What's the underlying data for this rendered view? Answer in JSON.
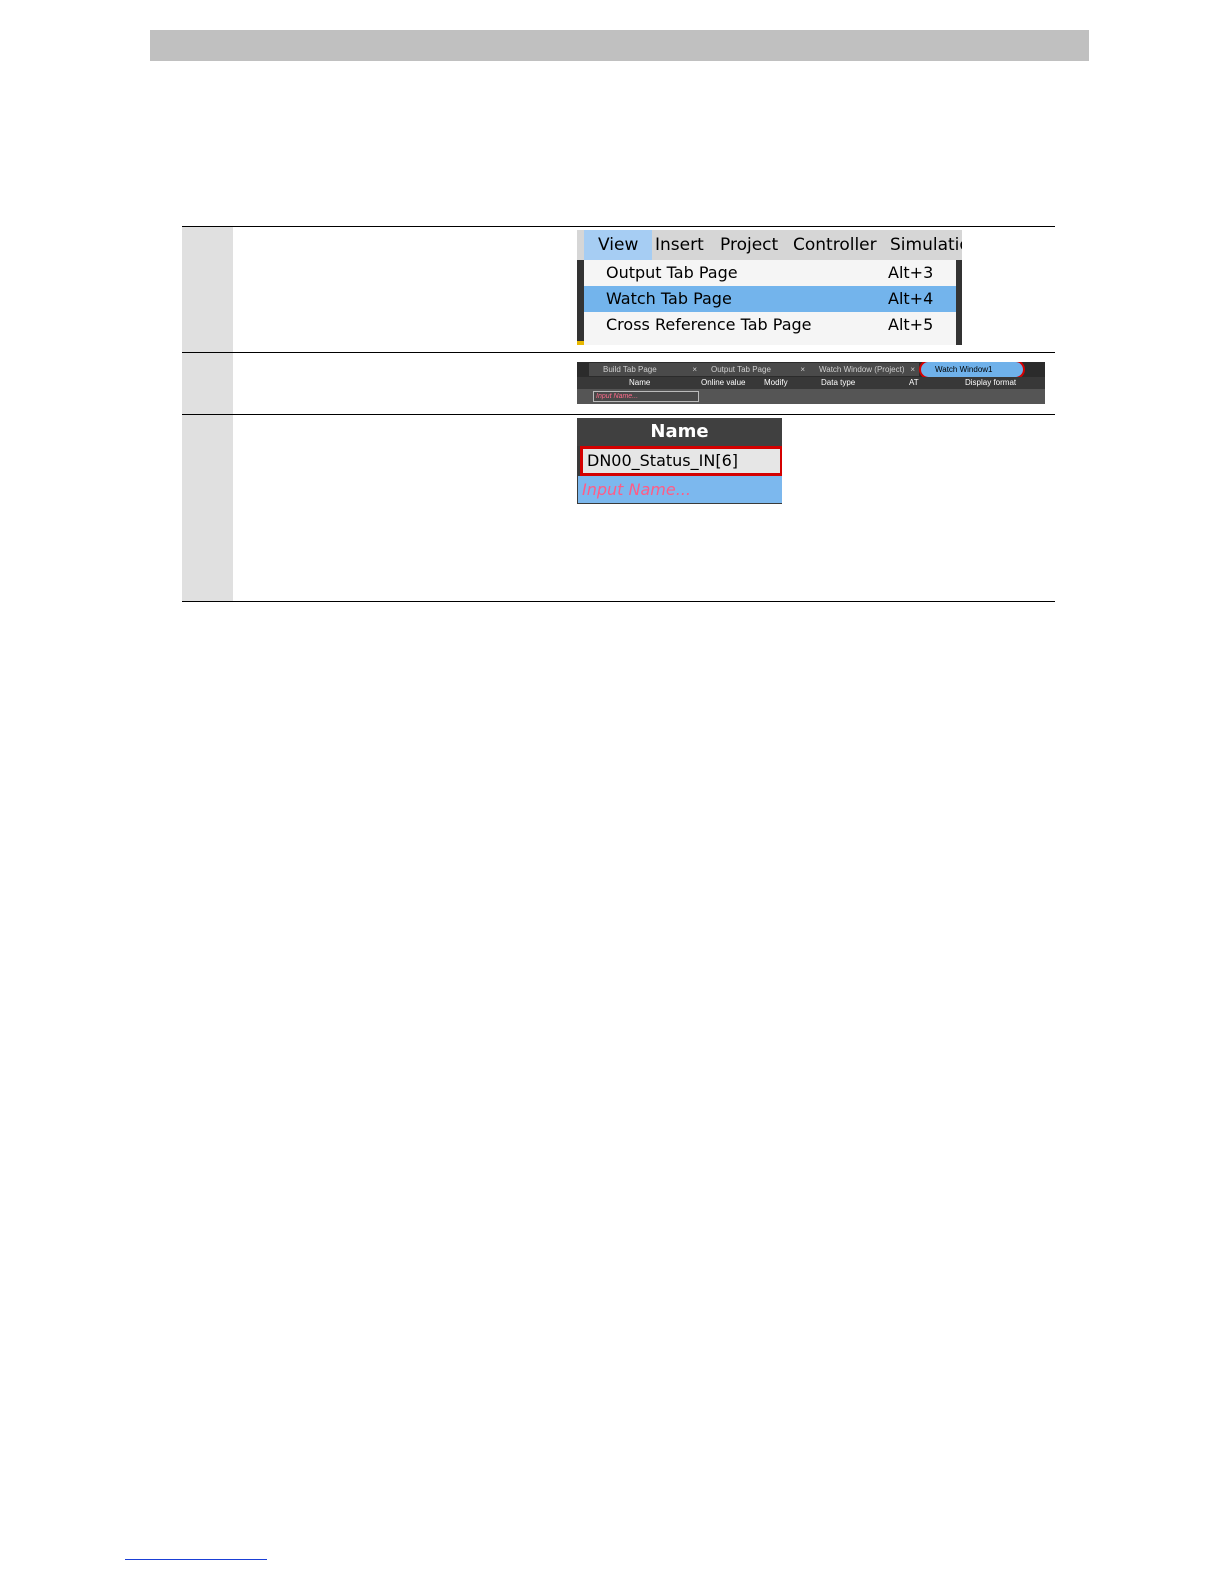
{
  "step1": {
    "menubar": [
      "View",
      "Insert",
      "Project",
      "Controller",
      "Simulation"
    ],
    "menu_items": [
      {
        "label": "Output Tab Page",
        "shortcut": "Alt+3"
      },
      {
        "label": "Watch Tab Page",
        "shortcut": "Alt+4"
      },
      {
        "label": "Cross Reference Tab Page",
        "shortcut": "Alt+5"
      }
    ]
  },
  "step2": {
    "tabs": [
      "Build Tab Page",
      "Output Tab Page",
      "Watch Window (Project)",
      "Watch Window1"
    ],
    "columns": [
      "Name",
      "Online value",
      "Modify",
      "Data type",
      "AT",
      "Display format"
    ],
    "input_placeholder": "Input Name..."
  },
  "step3": {
    "header": "Name",
    "value": "DN00_Status_IN[6]",
    "input_placeholder": "Input Name..."
  }
}
